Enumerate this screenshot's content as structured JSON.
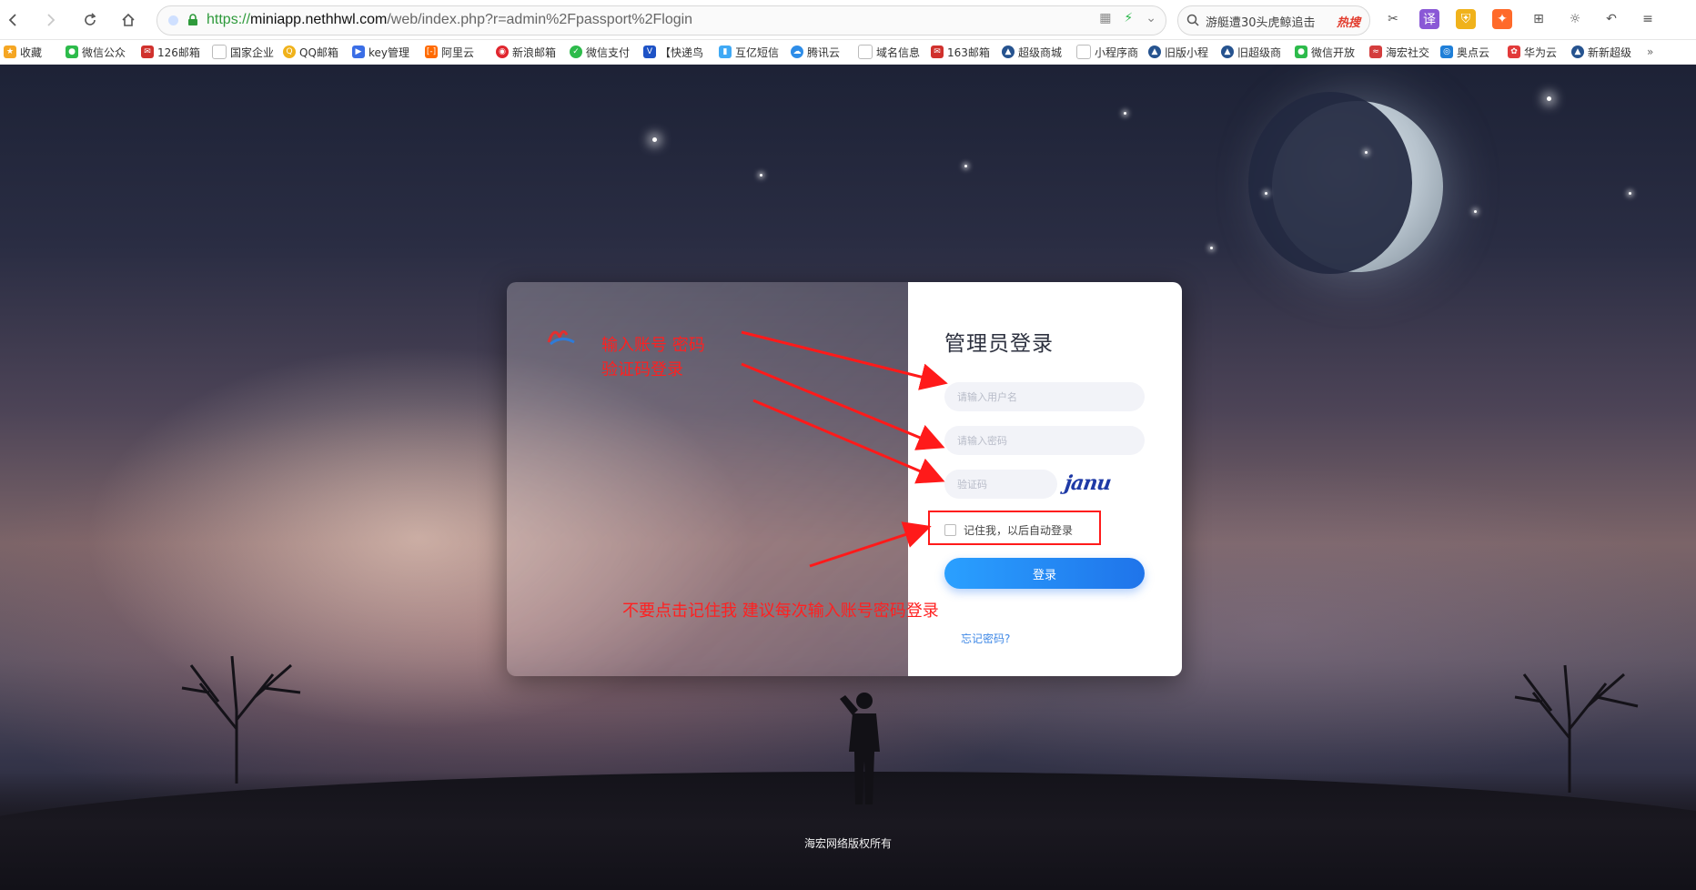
{
  "browser": {
    "url_scheme": "https://",
    "url_host": "miniapp.nethhwl.com",
    "url_path": "/web/index.php?r=admin%2Fpassport%2Flogin",
    "search_text": "游艇遭30头虎鲸追击",
    "search_hot": "热搜"
  },
  "bookmarks": [
    {
      "label": "收藏",
      "color": "#f5a623",
      "icon": "star-icon"
    },
    {
      "label": "微信公众",
      "color": "#2dbb4b",
      "icon": "wechat-icon"
    },
    {
      "label": "126邮箱",
      "color": "#d0312d",
      "icon": "mail-icon"
    },
    {
      "label": "国家企业",
      "color": "#9aa0a6",
      "icon": "page-icon"
    },
    {
      "label": "QQ邮箱",
      "color": "#f0b21b",
      "icon": "qq-icon"
    },
    {
      "label": "key管理",
      "color": "#3b6ee6",
      "icon": "key-icon"
    },
    {
      "label": "阿里云",
      "color": "#ff6a00",
      "icon": "aliyun-icon"
    },
    {
      "label": "新浪邮箱",
      "color": "#e0262e",
      "icon": "weibo-icon"
    },
    {
      "label": "微信支付",
      "color": "#2dbb4b",
      "icon": "wechat-pay-icon"
    },
    {
      "label": "【快递鸟",
      "color": "#1e53c6",
      "icon": "kdniao-icon"
    },
    {
      "label": "互亿短信",
      "color": "#3fa9f5",
      "icon": "sms-icon"
    },
    {
      "label": "腾讯云",
      "color": "#2e8de8",
      "icon": "tencent-cloud-icon"
    },
    {
      "label": "域名信息",
      "color": "#9aa0a6",
      "icon": "page-icon"
    },
    {
      "label": "163邮箱",
      "color": "#d0312d",
      "icon": "mail-icon"
    },
    {
      "label": "超级商城",
      "color": "#26538f",
      "icon": "shop-icon"
    },
    {
      "label": "小程序商",
      "color": "#9aa0a6",
      "icon": "page-icon"
    },
    {
      "label": "旧版小程",
      "color": "#26538f",
      "icon": "miniapp-icon"
    },
    {
      "label": "旧超级商",
      "color": "#26538f",
      "icon": "shop-icon"
    },
    {
      "label": "微信开放",
      "color": "#2dbb4b",
      "icon": "wechat-icon"
    },
    {
      "label": "海宏社交",
      "color": "#d43d3d",
      "icon": "haihong-icon"
    },
    {
      "label": "奥点云",
      "color": "#1f7fd8",
      "icon": "cloud-icon"
    },
    {
      "label": "华为云",
      "color": "#e23a3a",
      "icon": "huawei-icon"
    },
    {
      "label": "新新超级",
      "color": "#26538f",
      "icon": "shop-icon"
    }
  ],
  "bookmarks_more": "»",
  "login": {
    "title": "管理员登录",
    "username_placeholder": "请输入用户名",
    "password_placeholder": "请输入密码",
    "captcha_placeholder": "验证码",
    "captcha_image_text": "janu",
    "remember_label": "记住我，以后自动登录",
    "submit_label": "登录",
    "forgot_label": "忘记密码?"
  },
  "annotations": {
    "hint_line1": "输入账号 密码",
    "hint_line2": "验证码登录",
    "warning": "不要点击记住我  建议每次输入账号密码登录",
    "color": "#ff2020"
  },
  "footer": {
    "copyright": "海宏网络版权所有"
  }
}
